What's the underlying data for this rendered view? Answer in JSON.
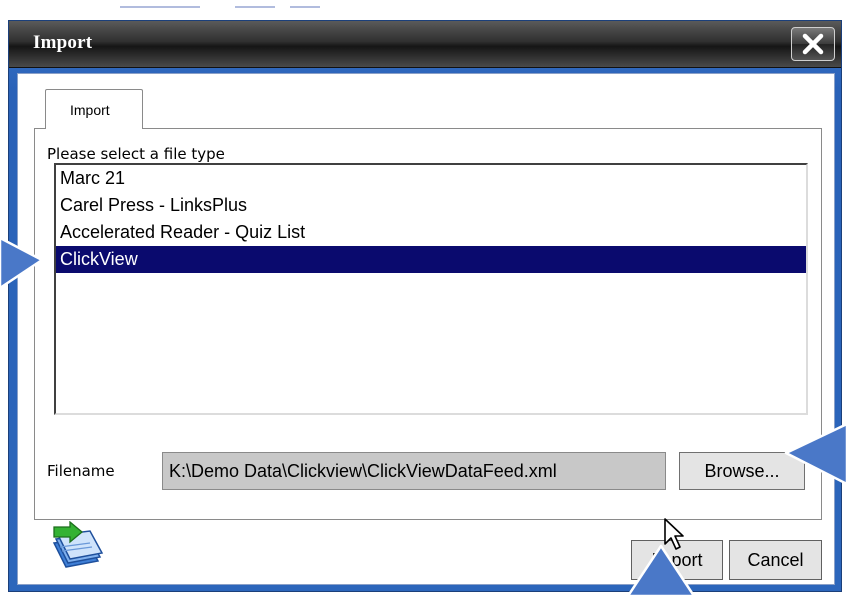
{
  "dialog": {
    "title": "Import",
    "close_icon": "close-x-icon"
  },
  "tabs": [
    {
      "label": "Import",
      "active": true
    }
  ],
  "file_type": {
    "label": "Please select a file type",
    "options": [
      "Marc 21",
      "Carel Press - LinksPlus",
      "Accelerated Reader - Quiz List",
      "ClickView"
    ],
    "selected": "ClickView"
  },
  "filename": {
    "label": "Filename",
    "value": "K:\\Demo Data\\Clickview\\ClickViewDataFeed.xml"
  },
  "buttons": {
    "browse": "Browse...",
    "import": "Import",
    "cancel": "Cancel"
  },
  "icons": {
    "app": "import-documents-icon",
    "cursor": "mouse-pointer-icon"
  },
  "colors": {
    "selection": "#0a0a6e",
    "callout_arrow": "#4a78c8",
    "frame": "#2c66bb"
  }
}
